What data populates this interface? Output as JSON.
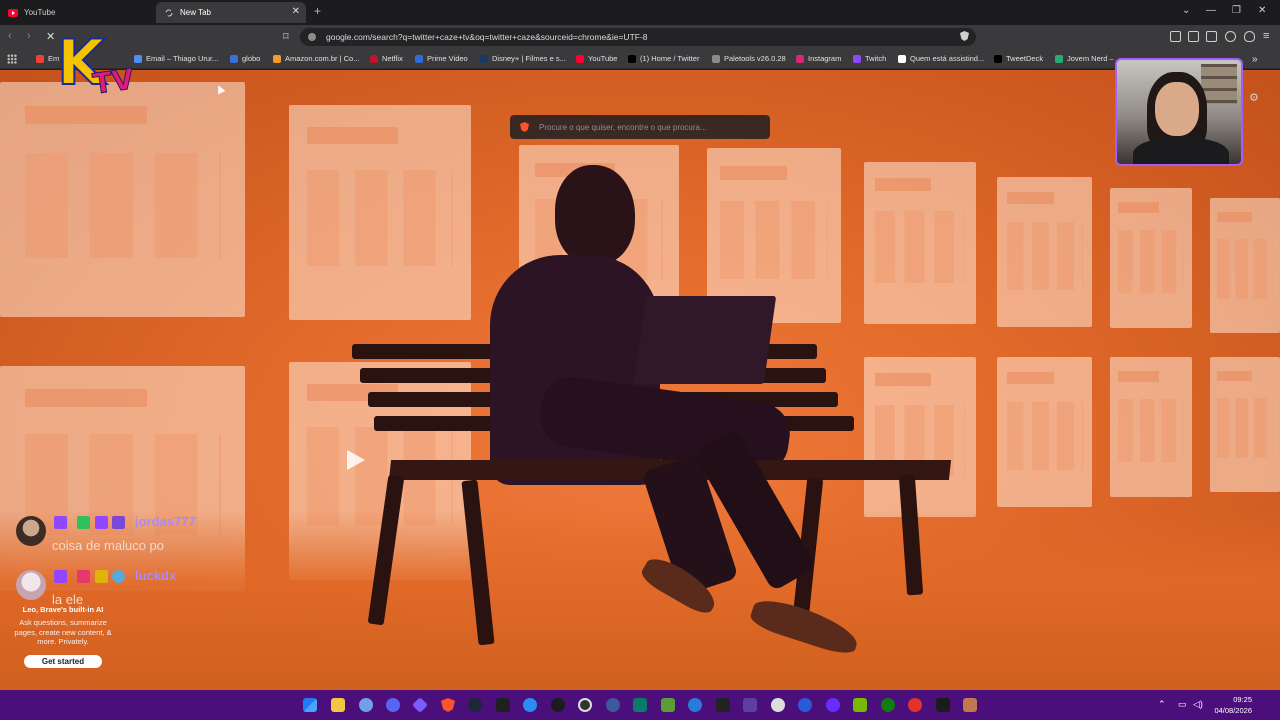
{
  "tabs": [
    {
      "title": "YouTube"
    },
    {
      "title": "New Tab"
    }
  ],
  "address_bar": {
    "url": "google.com/search?q=twitter+caze+tv&oq=twitter+caze&sourceid=chrome&ie=UTF-8"
  },
  "bookmarks": [
    {
      "label": "Em"
    },
    {
      "label": "Email – Thiago Urur..."
    },
    {
      "label": "globo"
    },
    {
      "label": "Amazon.com.br | Co..."
    },
    {
      "label": "Netflix"
    },
    {
      "label": "Prime Video"
    },
    {
      "label": "Disney+ | Filmes e s..."
    },
    {
      "label": "YouTube"
    },
    {
      "label": "(1) Home / Twitter"
    },
    {
      "label": "Paletools v26.0.28"
    },
    {
      "label": "Instagram"
    },
    {
      "label": "Twitch"
    },
    {
      "label": "Quem está assistind..."
    },
    {
      "label": "TweetDeck"
    },
    {
      "label": "Jovem Nerd – ..."
    }
  ],
  "new_tab": {
    "search_placeholder": "Procure o que quiser, encontre o que procura..."
  },
  "chat": [
    {
      "user": "jordas777",
      "message": "coisa de maluco po"
    },
    {
      "user": "luckdx",
      "message": "la ele"
    }
  ],
  "leo": {
    "title": "Leo, Brave's built-in AI",
    "description": "Ask questions, summarize pages, create new content, & more. Privately.",
    "button": "Get started"
  },
  "logo": {
    "k": "K",
    "tv": "TV"
  },
  "clock": {
    "time": "09:25",
    "date": "04/08/2026"
  },
  "colors": {
    "accent_orange": "#e26b2b",
    "taskbar": "#4a0f7a",
    "chat_username": "#a78bfa",
    "webcam_border": "#a65cff"
  }
}
